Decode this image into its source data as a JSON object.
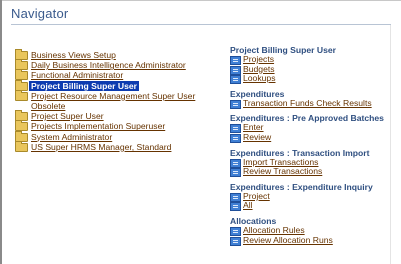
{
  "title": "Navigator",
  "responsibilities": [
    {
      "label": "Business Views Setup",
      "folder": true
    },
    {
      "label": "Daily Business Intelligence Administrator",
      "folder": true
    },
    {
      "label": "Functional Administrator",
      "folder": true
    },
    {
      "label": "Project Billing Super User",
      "folder": true,
      "selected": true
    },
    {
      "label": "Project Resource Management Super User",
      "folder": true
    },
    {
      "label": "Obsolete",
      "folder": false
    },
    {
      "label": "Project Super User",
      "folder": true
    },
    {
      "label": "Projects Implementation Superuser",
      "folder": true
    },
    {
      "label": "System Administrator",
      "folder": true
    },
    {
      "label": "US Super HRMS Manager, Standard",
      "folder": true
    }
  ],
  "panel": {
    "heading": "Project Billing Super User",
    "top_items": [
      "Projects",
      "Budgets",
      "Lookups"
    ],
    "sections": [
      {
        "heading": "Expenditures",
        "items": [
          "Transaction Funds Check Results"
        ]
      },
      {
        "heading": "Expenditures : Pre Approved Batches",
        "items": [
          "Enter",
          "Review"
        ]
      },
      {
        "heading": "Expenditures : Transaction Import",
        "items": [
          "Import Transactions",
          "Review Transactions"
        ]
      },
      {
        "heading": "Expenditures : Expenditure Inquiry",
        "items": [
          "Project",
          "All"
        ]
      },
      {
        "heading": "Allocations",
        "items": [
          "Allocation Rules",
          "Review Allocation Runs"
        ]
      }
    ]
  }
}
